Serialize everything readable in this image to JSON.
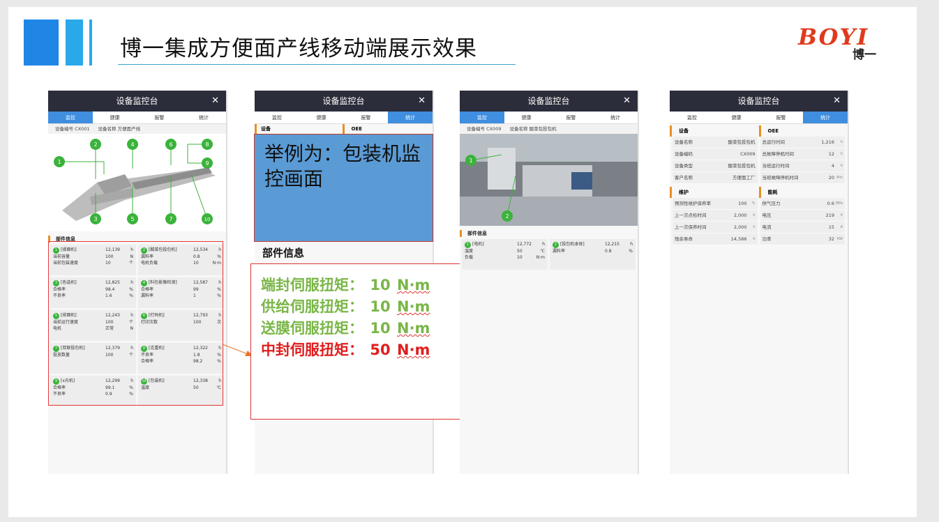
{
  "slide": {
    "title": "博一集成方便面产线移动端展示效果",
    "logo_text": "BOYI",
    "logo_sub": "博一"
  },
  "phones": {
    "header_title": "设备监控台",
    "close_glyph": "✕",
    "tabs": [
      "监控",
      "健康",
      "报警",
      "统计"
    ]
  },
  "phone1": {
    "device_no": "设备编号 CX001",
    "device_name": "设备名称 方便面产线",
    "callouts": [
      "1",
      "2",
      "3",
      "4",
      "5",
      "6",
      "7",
      "8",
      "9",
      "10"
    ],
    "section_title": "部件信息",
    "cards": [
      {
        "no": "1",
        "name": "[揉面机]",
        "hours": "12,139",
        "hu": "h",
        "rows": [
          [
            "当前容量",
            "100",
            "N"
          ],
          [
            "当前包装速度",
            "10",
            "个"
          ]
        ]
      },
      {
        "no": "2",
        "name": "[酸菜包投包机]",
        "hours": "12,534",
        "hu": "h",
        "rows": [
          [
            "漏料率",
            "0.8",
            "%"
          ],
          [
            "电机负载",
            "10",
            "N·m"
          ]
        ]
      },
      {
        "no": "3",
        "name": "[色选机]",
        "hours": "12,825",
        "hu": "h",
        "rows": [
          [
            "合格率",
            "98.4",
            "%"
          ],
          [
            "不良率",
            "1.6",
            "%"
          ]
        ]
      },
      {
        "no": "4",
        "name": "[料包影像检测]",
        "hours": "12,587",
        "hu": "h",
        "rows": [
          [
            "合格率",
            "99",
            "%"
          ],
          [
            "漏料率",
            "1",
            "%"
          ]
        ]
      },
      {
        "no": "5",
        "name": "[排面机]",
        "hours": "12,243",
        "hu": "h",
        "rows": [
          [
            "当前运行速度",
            "100",
            "个"
          ],
          [
            "电机",
            "正常",
            "N"
          ]
        ]
      },
      {
        "no": "6",
        "name": "[打码机]",
        "hours": "12,793",
        "hu": "h",
        "rows": [
          [
            "打印次数",
            "100",
            "次"
          ]
        ]
      },
      {
        "no": "7",
        "name": "[双联投包机]",
        "hours": "12,379",
        "hu": "h",
        "rows": [
          [
            "投放数量",
            "100",
            "个"
          ]
        ]
      },
      {
        "no": "8",
        "name": "[克重机]",
        "hours": "12,322",
        "hu": "h",
        "rows": [
          [
            "不良率",
            "1.8",
            "%"
          ],
          [
            "合格率",
            "98.2",
            "%"
          ]
        ]
      },
      {
        "no": "9",
        "name": "[x光机]",
        "hours": "12,299",
        "hu": "h",
        "rows": [
          [
            "合格率",
            "99.1",
            "%"
          ],
          [
            "不良率",
            "0.9",
            "%"
          ]
        ]
      },
      {
        "no": "10",
        "name": "[包装机]",
        "hours": "12,338",
        "hu": "h",
        "rows": [
          [
            "温度",
            "50",
            "℃"
          ]
        ]
      }
    ]
  },
  "phone2": {
    "left_head": "设备",
    "right_head": "OEE",
    "example_text": "举例为：包装机监控画面",
    "part_label": "部件信息",
    "torques": [
      {
        "label": "端封伺服扭矩：",
        "value": "10",
        "unit": "N·m",
        "color": "#7ab648"
      },
      {
        "label": "供给伺服扭矩：",
        "value": "10",
        "unit": "N·m",
        "color": "#7ab648"
      },
      {
        "label": "送膜伺服扭矩：",
        "value": "10",
        "unit": "N·m",
        "color": "#7ab648"
      },
      {
        "label": "中封伺服扭矩：",
        "value": "50",
        "unit": "N·m",
        "color": "#e01e1e"
      }
    ]
  },
  "phone3": {
    "device_no": "设备编号 CX009",
    "device_name": "设备名称 酸菜包投包机",
    "callouts": [
      "1",
      "2"
    ],
    "section_title": "部件信息",
    "cards": [
      {
        "no": "1",
        "name": "[电机]",
        "hours": "12,772",
        "hu": "h",
        "rows": [
          [
            "温度",
            "50",
            "℃"
          ],
          [
            "负载",
            "10",
            "N·m"
          ]
        ]
      },
      {
        "no": "2",
        "name": "[投包机本体]",
        "hours": "12,215",
        "hu": "h",
        "rows": [
          [
            "漏料率",
            "0.8",
            "%"
          ]
        ]
      }
    ]
  },
  "phone4": {
    "sec_device": "设备",
    "sec_oee": "OEE",
    "device_rows": [
      [
        "设备名称",
        "酸菜包投包机"
      ],
      [
        "设备编码",
        "CX009"
      ],
      [
        "设备类型",
        "酸菜包投包机"
      ],
      [
        "客户名称",
        "方便面工厂"
      ]
    ],
    "oee_rows": [
      [
        "总运行时间",
        "1,216",
        "h"
      ],
      [
        "总故障停机时间",
        "12",
        "h"
      ],
      [
        "当班运行时间",
        "4",
        "h"
      ],
      [
        "当班故障停机时间",
        "20",
        "Min"
      ]
    ],
    "sec_maint": "维护",
    "sec_energy": "能耗",
    "maint_rows": [
      [
        "预测性维护保养率",
        "100",
        "%"
      ],
      [
        "上一次点检时间",
        "2,000",
        "h"
      ],
      [
        "上一次保养时间",
        "2,000",
        "h"
      ],
      [
        "残余寿命",
        "14,586",
        "h"
      ]
    ],
    "energy_rows": [
      [
        "供气压力",
        "0.6",
        "MPa"
      ],
      [
        "电压",
        "219",
        "V"
      ],
      [
        "电流",
        "15",
        "A"
      ],
      [
        "功率",
        "32",
        "KW"
      ]
    ]
  }
}
